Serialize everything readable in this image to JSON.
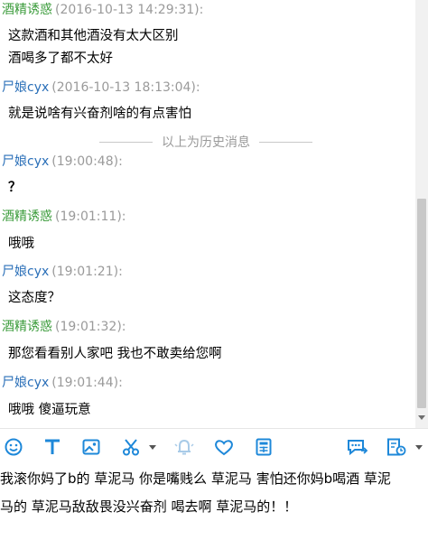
{
  "chat": {
    "messages": [
      {
        "sender": "酒精诱惑",
        "time": "(2016-10-13 14:29:31):",
        "lines": [
          "这款酒和其他酒没有太大区别",
          "酒喝多了都不太好"
        ]
      },
      {
        "sender": "尸娘cyx",
        "time": "(2016-10-13 18:13:04):",
        "lines": [
          "就是说啥有兴奋剂啥的有点害怕"
        ]
      },
      {
        "sender": "尸娘cyx",
        "time": "(19:00:48):",
        "lines": [
          "？"
        ]
      },
      {
        "sender": "酒精诱惑",
        "time": "(19:01:11):",
        "lines": [
          "哦哦"
        ]
      },
      {
        "sender": "尸娘cyx",
        "time": "(19:01:21):",
        "lines": [
          "这态度？"
        ]
      },
      {
        "sender": "酒精诱惑",
        "time": "(19:01:32):",
        "lines": [
          "那您看看别人家吧 我也不敢卖给您啊"
        ]
      },
      {
        "sender": "尸娘cyx",
        "time": "(19:01:44):",
        "lines": [
          "哦哦   傻逼玩意"
        ]
      }
    ],
    "history_divider": "以上为历史消息"
  },
  "colors": {
    "sender_green": "#3a9b3a",
    "sender_blue": "#2a6fb8",
    "icon_blue": "#1e88d9",
    "timestamp_gray": "#9a9a9a"
  },
  "toolbar": {
    "icons": [
      "emoji-icon",
      "font-icon",
      "image-icon",
      "scissors-icon",
      "bell-icon",
      "heart-icon",
      "calculator-icon",
      "chat-bubble-icon",
      "message-history-icon"
    ]
  },
  "input": {
    "lines": [
      "我滚你妈了b的 草泥马 你是嘴贱么 草泥马 害怕还你妈b喝酒 草泥",
      "马的 草泥马敌敌畏没兴奋剂 喝去啊 草泥马的！！"
    ]
  }
}
